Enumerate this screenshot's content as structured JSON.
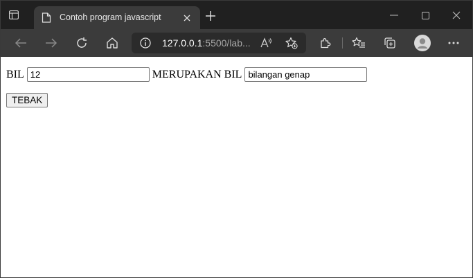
{
  "browser": {
    "tab": {
      "title": "Contoh program javascript",
      "icon": "page-icon"
    },
    "address_bar": {
      "host": "127.0.0.1",
      "rest": ":5500/lab..."
    },
    "colors": {
      "tabstrip": "#202020",
      "toolbar": "#3b3b3b",
      "address_bg": "#2b2b2b"
    }
  },
  "page": {
    "label_bil": "BIL",
    "input_bil_value": "12",
    "label_merupakan": "MERUPAKAN BIL",
    "input_result_value": "bilangan genap",
    "button_label": "TEBAK"
  }
}
